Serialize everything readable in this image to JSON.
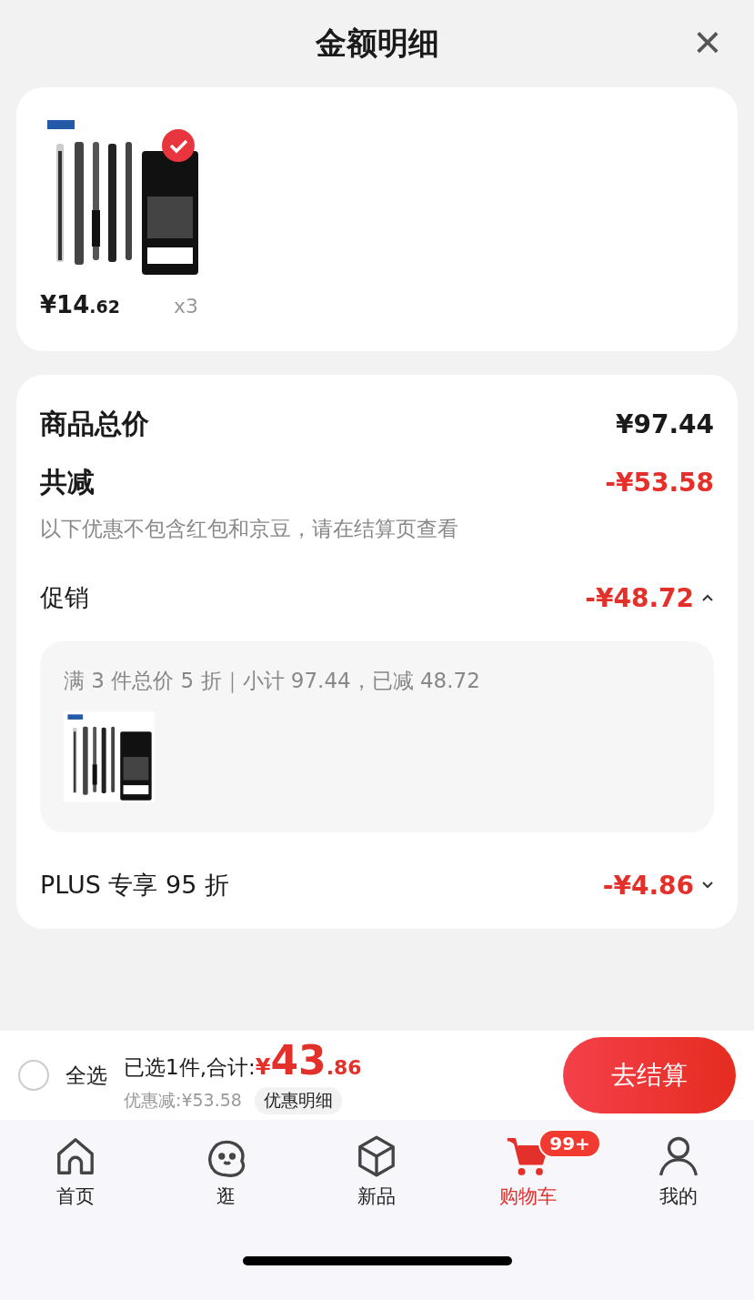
{
  "header": {
    "title": "金额明细",
    "close": "×"
  },
  "products": [
    {
      "kind": "picture",
      "checked": true,
      "price_main": "¥14",
      "price_decimal": ".62",
      "quantity": "x3"
    }
  ],
  "summary": {
    "total_label": "商品总价",
    "total_value": "¥97.44",
    "reduce_label": "共减",
    "reduce_value": "-¥53.58",
    "note": "以下优惠不包含红包和京豆，请在结算页查看",
    "discounts": [
      {
        "label": "促销",
        "value": "-¥48.72",
        "expanded": true,
        "detail": "满 3 件总价 5 折｜小计 97.44，已减 48.72"
      },
      {
        "label": "PLUS 专享 95 折",
        "value": "-¥4.86",
        "expanded": false
      }
    ]
  },
  "checkout": {
    "select_all": {
      "label": "全选",
      "checked": false
    },
    "selected_text": "已选1件,合计:",
    "currency": "¥",
    "amount": "43",
    "decimal": ".86",
    "saving": "优惠减:¥53.58",
    "detail_link": "优惠明细",
    "button": "去结算"
  },
  "nav": [
    {
      "label": "首页",
      "kind": "home",
      "selected": false
    },
    {
      "label": "逛",
      "kind": "face",
      "selected": false
    },
    {
      "label": "新品",
      "kind": "cube",
      "selected": false
    },
    {
      "label": "购物车",
      "kind": "cart",
      "selected": true,
      "badge": "99+"
    },
    {
      "label": "我的",
      "kind": "person",
      "selected": false
    }
  ]
}
